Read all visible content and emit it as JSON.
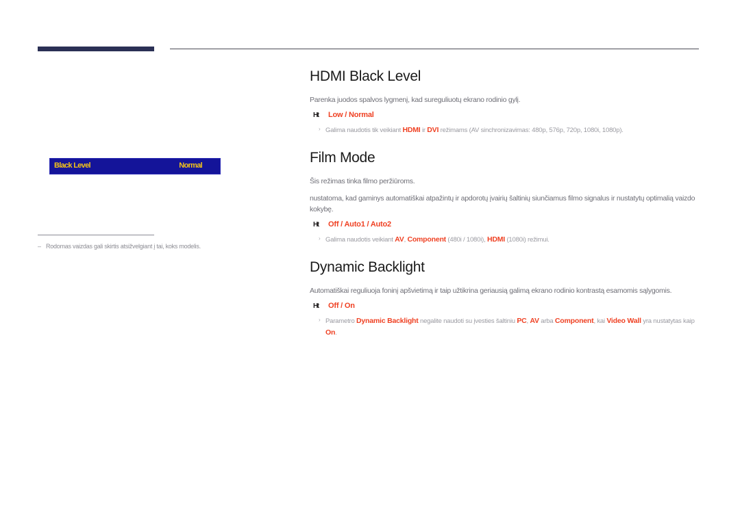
{
  "page": {
    "language": "lt",
    "accent_red": "#ef4123",
    "osd_blue": "#141499",
    "osd_yellow": "#f5c518",
    "header_navy": "#2b3055"
  },
  "osd_menu": {
    "label": "Black Level",
    "value": "Normal"
  },
  "footnote": {
    "dash": "–",
    "text": "Rodomas vaizdas gali skirtis atsižvelgiant į tai, koks modelis."
  },
  "sections": [
    {
      "id": "hdmi-black-level",
      "title": "HDMI Black Level",
      "description": "Parenka juodos spalvos lygmenį, kad sureguliuotų ekrano rodinio gylį.",
      "option_marker": "Ht",
      "options": "Low / Normal",
      "notes": [
        {
          "bullet": "›",
          "parts": [
            {
              "text": "Galima naudotis tik veikiant ",
              "style": "plain"
            },
            {
              "text": "HDMI",
              "style": "hl"
            },
            {
              "text": " ir ",
              "style": "plain"
            },
            {
              "text": "DVI",
              "style": "hl"
            },
            {
              "text": " režimams (AV sinchronizavimas: 480p, 576p, 720p, 1080i, 1080p).",
              "style": "plain"
            }
          ]
        }
      ]
    },
    {
      "id": "film-mode",
      "title": "Film Mode",
      "description": "Šis režimas tinka filmo peržiūroms.",
      "description2": "nustatoma, kad gaminys automatiškai atpažintų ir apdorotų įvairių šaltinių siunčiamus filmo signalus ir nustatytų optimalią vaizdo kokybę.",
      "option_marker": "Ht",
      "options": "Off / Auto1 / Auto2",
      "notes": [
        {
          "bullet": "›",
          "parts": [
            {
              "text": "Galima naudotis veikiant ",
              "style": "plain"
            },
            {
              "text": "AV",
              "style": "hl"
            },
            {
              "text": ", ",
              "style": "plain"
            },
            {
              "text": "Component",
              "style": "hl"
            },
            {
              "text": " (480i / 1080i), ",
              "style": "plain"
            },
            {
              "text": "HDMI",
              "style": "hl"
            },
            {
              "text": " (1080i) režimui.",
              "style": "plain"
            }
          ]
        }
      ]
    },
    {
      "id": "dynamic-backlight",
      "title": "Dynamic Backlight",
      "description": "Automatiškai reguliuoja foninį apšvietimą ir taip užtikrina geriausią galimą ekrano rodinio kontrastą esamomis sąlygomis.",
      "option_marker": "Ht",
      "options": "Off / On",
      "notes": [
        {
          "bullet": "›",
          "parts": [
            {
              "text": "Parametro ",
              "style": "plain"
            },
            {
              "text": "Dynamic Backlight",
              "style": "hl"
            },
            {
              "text": " negalite naudoti su įvesties šaltiniu ",
              "style": "plain"
            },
            {
              "text": "PC",
              "style": "hl"
            },
            {
              "text": ", ",
              "style": "plain"
            },
            {
              "text": "AV",
              "style": "hl"
            },
            {
              "text": " arba ",
              "style": "plain"
            },
            {
              "text": "Component",
              "style": "hl"
            },
            {
              "text": ", kai ",
              "style": "plain"
            },
            {
              "text": "Video Wall",
              "style": "hl"
            },
            {
              "text": " yra nustatytas kaip ",
              "style": "plain"
            },
            {
              "text": "On",
              "style": "hl"
            },
            {
              "text": ".",
              "style": "plain"
            }
          ]
        }
      ]
    }
  ]
}
